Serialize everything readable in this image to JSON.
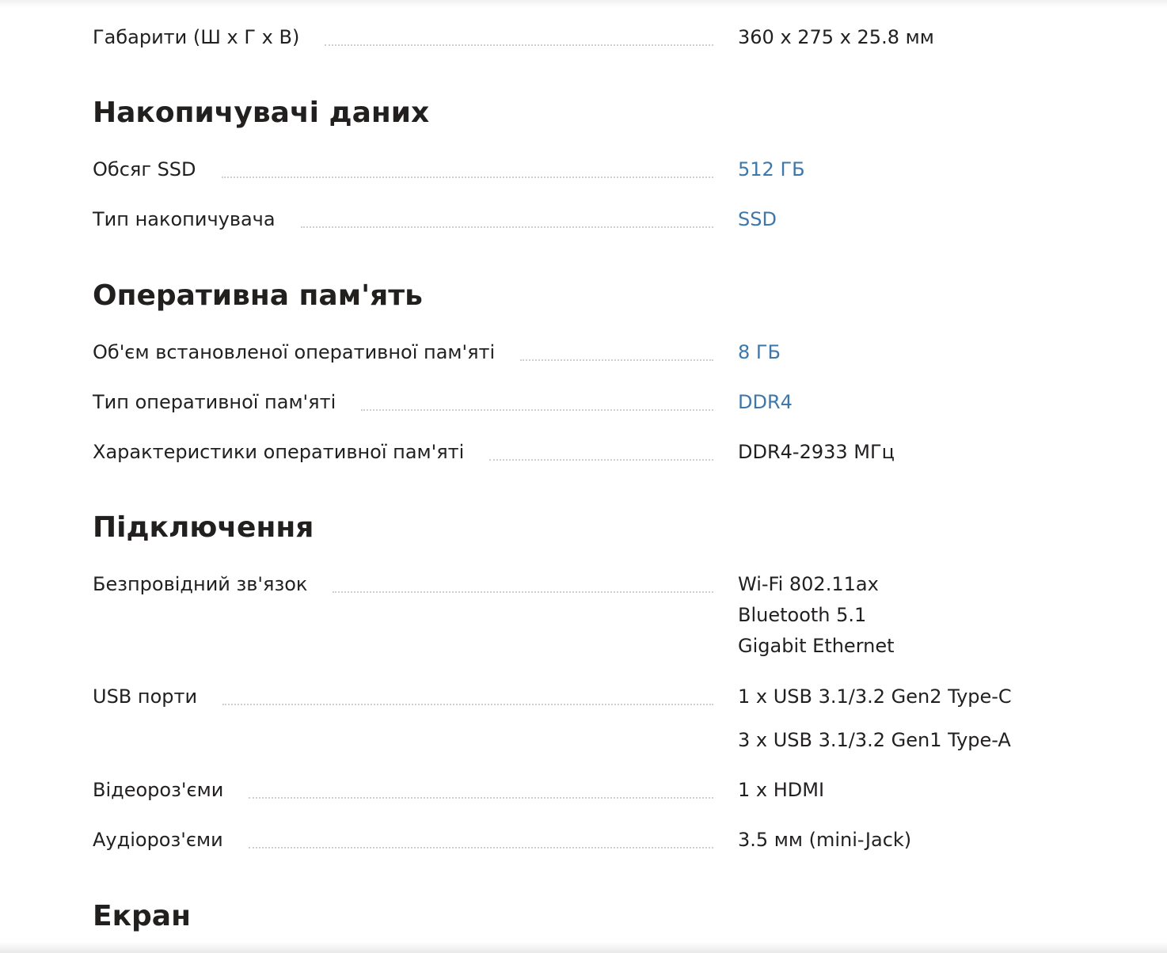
{
  "dimensions_row": {
    "label": "Габарити (Ш х Г х В)",
    "value": "360 x 275 x 25.8 мм"
  },
  "sections": {
    "storage": {
      "title": "Накопичувачі даних",
      "rows": [
        {
          "label": "Обсяг SSD",
          "value": "512 ГБ"
        },
        {
          "label": "Тип накопичувача",
          "value": "SSD"
        }
      ]
    },
    "memory": {
      "title": "Оперативна пам'ять",
      "rows": [
        {
          "label": "Об'єм встановленої оперативної пам'яті",
          "value": "8 ГБ"
        },
        {
          "label": "Тип оперативної пам'яті",
          "value": "DDR4"
        },
        {
          "label": "Характеристики оперативної пам'яті",
          "value": "DDR4-2933 МГц"
        }
      ]
    },
    "connectivity": {
      "title": "Підключення",
      "rows": [
        {
          "label": "Безпровідний зв'язок",
          "values": [
            "Wi-Fi 802.11ax",
            "Bluetooth 5.1",
            "Gigabit Ethernet"
          ]
        },
        {
          "label": "USB порти",
          "values": [
            "1 x USB 3.1/3.2 Gen2 Type-C",
            "3 x USB 3.1/3.2 Gen1 Type-A"
          ]
        },
        {
          "label": "Відеороз'єми",
          "value": "1 x HDMI"
        },
        {
          "label": "Аудіороз'єми",
          "value": "3.5 мм (mini-Jack)"
        }
      ]
    },
    "screen": {
      "title": "Екран"
    }
  },
  "colors": {
    "text": "#221f1f",
    "link": "#3e77aa",
    "leader": "#cfcfcf"
  }
}
